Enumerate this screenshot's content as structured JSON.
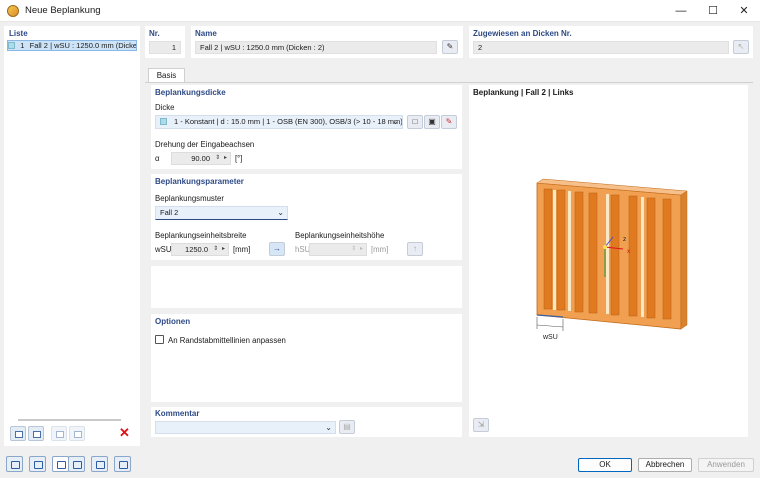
{
  "window": {
    "title": "Neue Beplankung",
    "minimize": "—",
    "maximize": "☐",
    "close": "✕"
  },
  "list": {
    "header": "Liste",
    "items": [
      {
        "num": "1",
        "label": "Fall 2 | wSU : 1250.0 mm (Dicken",
        "swatch_color": "#aedbea"
      }
    ]
  },
  "nr": {
    "label": "Nr.",
    "value": "1"
  },
  "name": {
    "label": "Name",
    "value": "Fall 2 | wSU : 1250.0 mm (Dicken : 2)"
  },
  "assigned": {
    "label": "Zugewiesen an Dicken Nr.",
    "value": "2"
  },
  "tabs": [
    {
      "label": "Basis",
      "active": true
    }
  ],
  "thickness_section": {
    "header": "Beplankungsdicke",
    "dicke_label": "Dicke",
    "dicke_value": "1 - Konstant | d : 15.0 mm | 1 - OSB (EN 300), OSB/3 (> 10 - 18 mm)",
    "rotation_label": "Drehung der Eingabeachsen",
    "alpha_symbol": "α",
    "alpha_value": "90.00",
    "alpha_unit": "[°]"
  },
  "params_section": {
    "header": "Beplankungsparameter",
    "pattern_label": "Beplankungsmuster",
    "pattern_value": "Fall 2",
    "width_label": "Beplankungseinheitsbreite",
    "width_symbol": "wSU",
    "width_value": "1250.0",
    "width_unit": "[mm]",
    "height_label": "Beplankungseinheitshöhe",
    "height_symbol": "hSU",
    "height_value": "",
    "height_unit": "[mm]"
  },
  "options_section": {
    "header": "Optionen",
    "checkbox_label": "An Randstabmittellinien anpassen",
    "checked": false
  },
  "comment_section": {
    "header": "Kommentar",
    "value": ""
  },
  "preview": {
    "title": "Beplankung | Fall 2 | Links",
    "dimension_label": "wSU",
    "axis_x": "x",
    "axis_z": "z"
  },
  "buttons": {
    "ok": "OK",
    "cancel": "Abbrechen",
    "apply": "Anwenden"
  },
  "colors": {
    "accent": "#2e4a86",
    "selection": "#cde3f7",
    "panel_orange": "#f0a050",
    "stud_orange": "#e07a20"
  }
}
